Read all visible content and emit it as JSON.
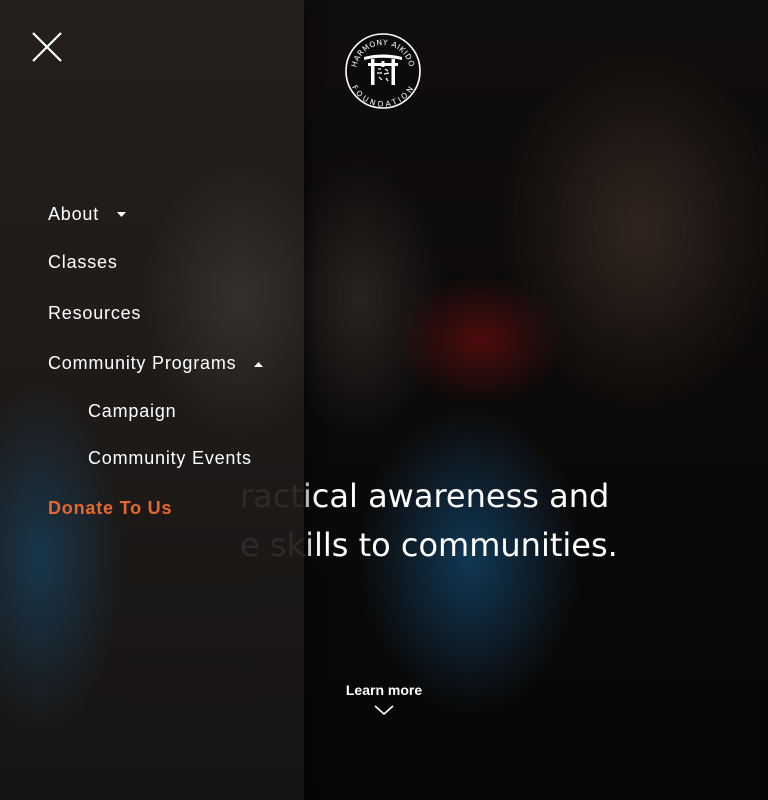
{
  "hero": {
    "tagline_line1": "ractical awareness and",
    "tagline_line2": "e skills to communities.",
    "learn_more": "Learn more"
  },
  "logo": {
    "text_top": "HARMONY AIKIDO",
    "text_bottom": "FOUNDATION"
  },
  "menu": {
    "items": [
      {
        "label": "About"
      },
      {
        "label": "Classes"
      },
      {
        "label": "Resources"
      },
      {
        "label": "Community Programs"
      },
      {
        "label": "Campaign"
      },
      {
        "label": "Community Events"
      },
      {
        "label": "Donate To Us"
      }
    ]
  },
  "colors": {
    "accent": "#e8672c",
    "panel": "#221e1c"
  },
  "icons": [
    "close-icon",
    "caret-down-icon",
    "caret-up-icon",
    "chevron-down-icon",
    "torii-gate-logo"
  ]
}
